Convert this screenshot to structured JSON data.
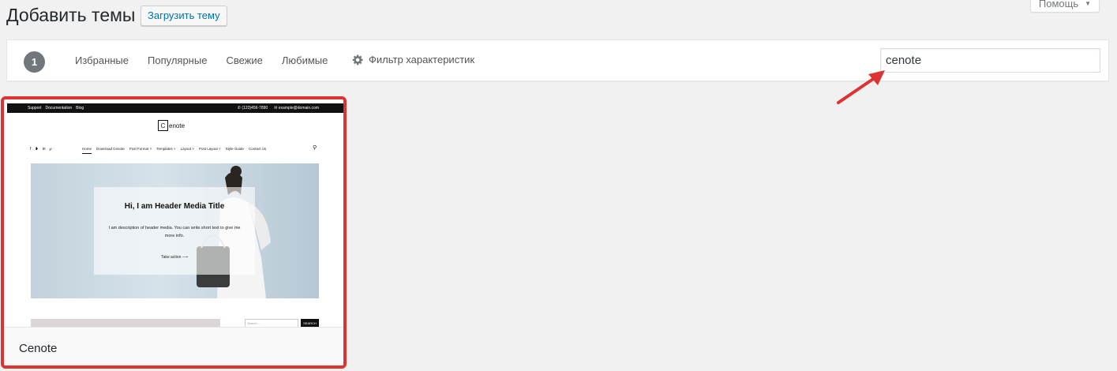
{
  "help_tab": {
    "label": "Помощь"
  },
  "page": {
    "title": "Добавить темы",
    "upload_button": "Загрузить тему"
  },
  "filter": {
    "count": "1",
    "links": [
      "Избранные",
      "Популярные",
      "Свежие",
      "Любимые"
    ],
    "feature_filter": "Фильтр характеристик",
    "search_value": "cenote"
  },
  "theme": {
    "name": "Cenote",
    "preview": {
      "top_links": [
        "Support",
        "Documentation",
        "Blog"
      ],
      "phone": "(123)456-7890",
      "email": "example@domain.com",
      "logo_letter": "C",
      "logo_rest": "enote",
      "nav": [
        "Home",
        "Download Cenote",
        "Post Format",
        "Templates",
        "Layout",
        "Post Layout",
        "Style Guide",
        "Contact Us"
      ],
      "hero_title": "Hi, I am Header Media Title",
      "hero_desc": "I am description of header media. You can write short text to give me more info.",
      "hero_cta": "Take action",
      "search_placeholder": "Search ...",
      "search_button": "SEARCH"
    }
  },
  "colors": {
    "highlight_border": "#dd3333",
    "link": "#0073aa",
    "arrow": "#dd3333"
  }
}
